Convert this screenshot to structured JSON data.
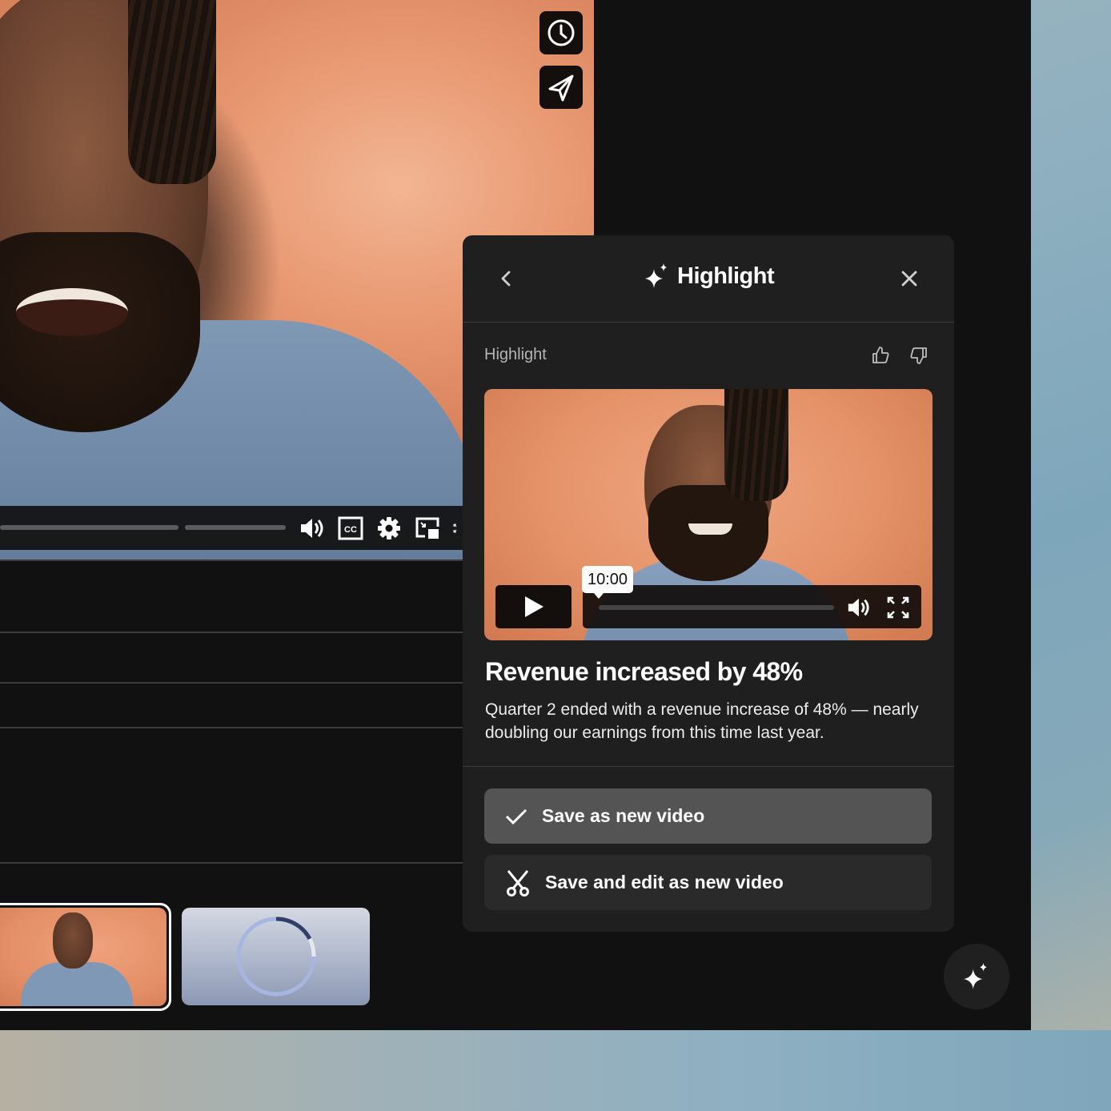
{
  "main_video": {
    "controls": {
      "volume_icon": "volume-icon",
      "captions_label": "CC",
      "settings_icon": "gear-icon",
      "pip_icon": "picture-in-picture-icon",
      "fullscreen_icon": "fullscreen-icon"
    }
  },
  "side_toolbar": {
    "items": [
      {
        "icon": "clock-icon"
      },
      {
        "icon": "send-icon"
      }
    ]
  },
  "panel": {
    "title": "Highlight",
    "title_icon": "sparkle-icon",
    "back_icon": "chevron-left-icon",
    "close_icon": "close-icon",
    "section_label": "Highlight",
    "feedback": {
      "up": "thumbs-up-icon",
      "down": "thumbs-down-icon"
    },
    "clip": {
      "timestamp": "10:00",
      "progress": 0
    },
    "headline": "Revenue increased by 48%",
    "description": "Quarter 2 ended with a revenue increase of 48% — nearly doubling our earnings from this time last year.",
    "actions": [
      {
        "label": "Save as new video",
        "icon": "check-icon"
      },
      {
        "label": "Save and edit as new video",
        "icon": "scissors-icon"
      }
    ]
  },
  "thumbnails": [
    {
      "state": "selected"
    },
    {
      "state": "loading",
      "progress": 0.25
    }
  ],
  "fab": {
    "icon": "sparkle-icon"
  },
  "colors": {
    "panel_bg": "#1f1f1f",
    "app_bg": "#111111",
    "primary_action_bg": "#545454",
    "secondary_action_bg": "#2a2a2a",
    "accent_video_bg": "#e99a73"
  }
}
